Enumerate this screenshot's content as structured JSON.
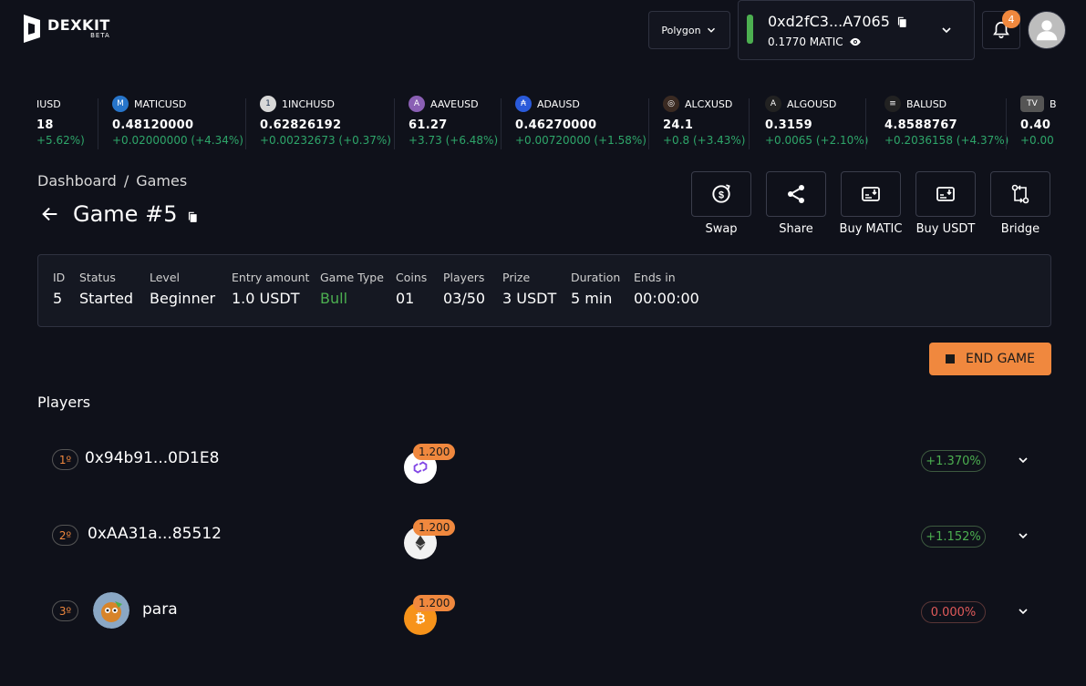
{
  "header": {
    "brand": "DEXKIT",
    "brand_sub": "BETA",
    "network": "Polygon",
    "wallet_address": "0xd2fC3...A7065",
    "wallet_balance": "0.1770 MATIC",
    "notification_count": "4",
    "status_color": "#4caf50",
    "accent_color": "#f0883e"
  },
  "ticker": [
    {
      "symbol": "IUSD",
      "price": "18",
      "change": "+5.62%)",
      "icon": "partial-coin-icon",
      "color": "#444"
    },
    {
      "symbol": "MATICUSD",
      "price": "0.48120000",
      "change": "+0.02000000 (+4.34%)",
      "icon": "matic-icon",
      "color": "#2775ca"
    },
    {
      "symbol": "1INCHUSD",
      "price": "0.62826192",
      "change": "+0.00232673 (+0.37%)",
      "icon": "1inch-icon",
      "color": "#1b314f"
    },
    {
      "symbol": "AAVEUSD",
      "price": "61.27",
      "change": "+3.73 (+6.48%)",
      "icon": "aave-icon",
      "color": "#8a5fb4"
    },
    {
      "symbol": "ADAUSD",
      "price": "0.46270000",
      "change": "+0.00720000 (+1.58%)",
      "icon": "ada-icon",
      "color": "#2a5ada"
    },
    {
      "symbol": "ALCXUSD",
      "price": "24.1",
      "change": "+0.8 (+3.43%)",
      "icon": "alcx-icon",
      "color": "#3a2a22"
    },
    {
      "symbol": "ALGOUSD",
      "price": "0.3159",
      "change": "+0.0065 (+2.10%)",
      "icon": "algo-icon",
      "color": "#222"
    },
    {
      "symbol": "BALUSD",
      "price": "4.8588767",
      "change": "+0.2036158 (+4.37%)",
      "icon": "bal-icon",
      "color": "#222"
    },
    {
      "symbol": "B",
      "price": "0.40",
      "change": "+0.00",
      "icon": "tradingview-icon",
      "color": "#333"
    }
  ],
  "breadcrumb": {
    "first": "Dashboard",
    "separator": "/",
    "second": "Games"
  },
  "title": "Game #5",
  "actions": [
    {
      "label": "Swap",
      "icon": "swap-icon"
    },
    {
      "label": "Share",
      "icon": "share-icon"
    },
    {
      "label": "Buy MATIC",
      "icon": "buy-icon"
    },
    {
      "label": "Buy USDT",
      "icon": "buy-icon"
    },
    {
      "label": "Bridge",
      "icon": "bridge-icon"
    }
  ],
  "info": {
    "id": {
      "label": "ID",
      "value": "5"
    },
    "status": {
      "label": "Status",
      "value": "Started"
    },
    "level": {
      "label": "Level",
      "value": "Beginner"
    },
    "entry": {
      "label": "Entry amount",
      "value": "1.0 USDT"
    },
    "type": {
      "label": "Game Type",
      "value": "Bull",
      "color": "#4caf50"
    },
    "coins": {
      "label": "Coins",
      "value": "01"
    },
    "players": {
      "label": "Players",
      "value": "03/50"
    },
    "prize": {
      "label": "Prize",
      "value": "3 USDT"
    },
    "duration": {
      "label": "Duration",
      "value": "5 min"
    },
    "ends": {
      "label": "Ends in",
      "value": "00:00:00"
    }
  },
  "end_game_label": "END GAME",
  "players_title": "Players",
  "players": [
    {
      "rank": "1º",
      "name": "0x94b91...0D1E8",
      "multiplier": "1.200",
      "coin": "matic-icon",
      "change": "+1.370%",
      "change_type": "pos"
    },
    {
      "rank": "2º",
      "name": "0xAA31a...85512",
      "multiplier": "1.200",
      "coin": "eth-icon",
      "change": "+1.152%",
      "change_type": "pos"
    },
    {
      "rank": "3º",
      "name": "para",
      "multiplier": "1.200",
      "coin": "btc-icon",
      "change": "0.000%",
      "change_type": "zero"
    }
  ]
}
